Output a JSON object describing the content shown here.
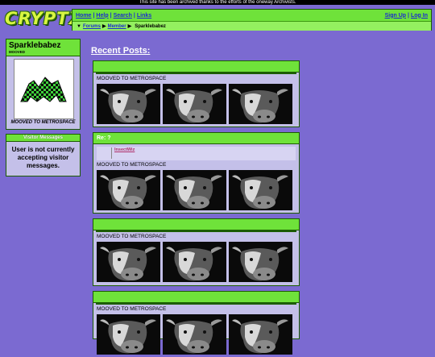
{
  "archive_notice": "This site has been archived thanks to the efforts of the oneway Archivists.",
  "logo": "CRYPTX",
  "topnav": {
    "links": [
      "Home",
      "Help",
      "Search",
      "Links"
    ],
    "right_links": [
      "Sign Up",
      "Log In"
    ],
    "breadcrumb": [
      "Forums",
      "Member",
      "Sparklebabez"
    ]
  },
  "profile": {
    "username": "Sparklebabez",
    "status": "MOOVED",
    "avatar_caption": "MOOVED TO METROSPACE"
  },
  "visitor_messages": {
    "title": "Visitor Messages",
    "body": "User is not currently accepting visitor messages."
  },
  "recent_posts": {
    "title": "Recent Posts:",
    "posts": [
      {
        "title": "",
        "text": "MOOVED TO METROSPACE"
      },
      {
        "title": "Re: ?",
        "quote_author": "InsectWiz",
        "text": "MOOVED TO METROSPACE"
      },
      {
        "title": "",
        "text": "MOOVED TO METROSPACE"
      },
      {
        "title": "",
        "text": "MOOVED TO METROSPACE"
      }
    ]
  },
  "colors": {
    "background": "#7b6ad1",
    "accent_green": "#6fe23a",
    "panel": "#c4c0e9",
    "link": "#1a2bd0"
  }
}
